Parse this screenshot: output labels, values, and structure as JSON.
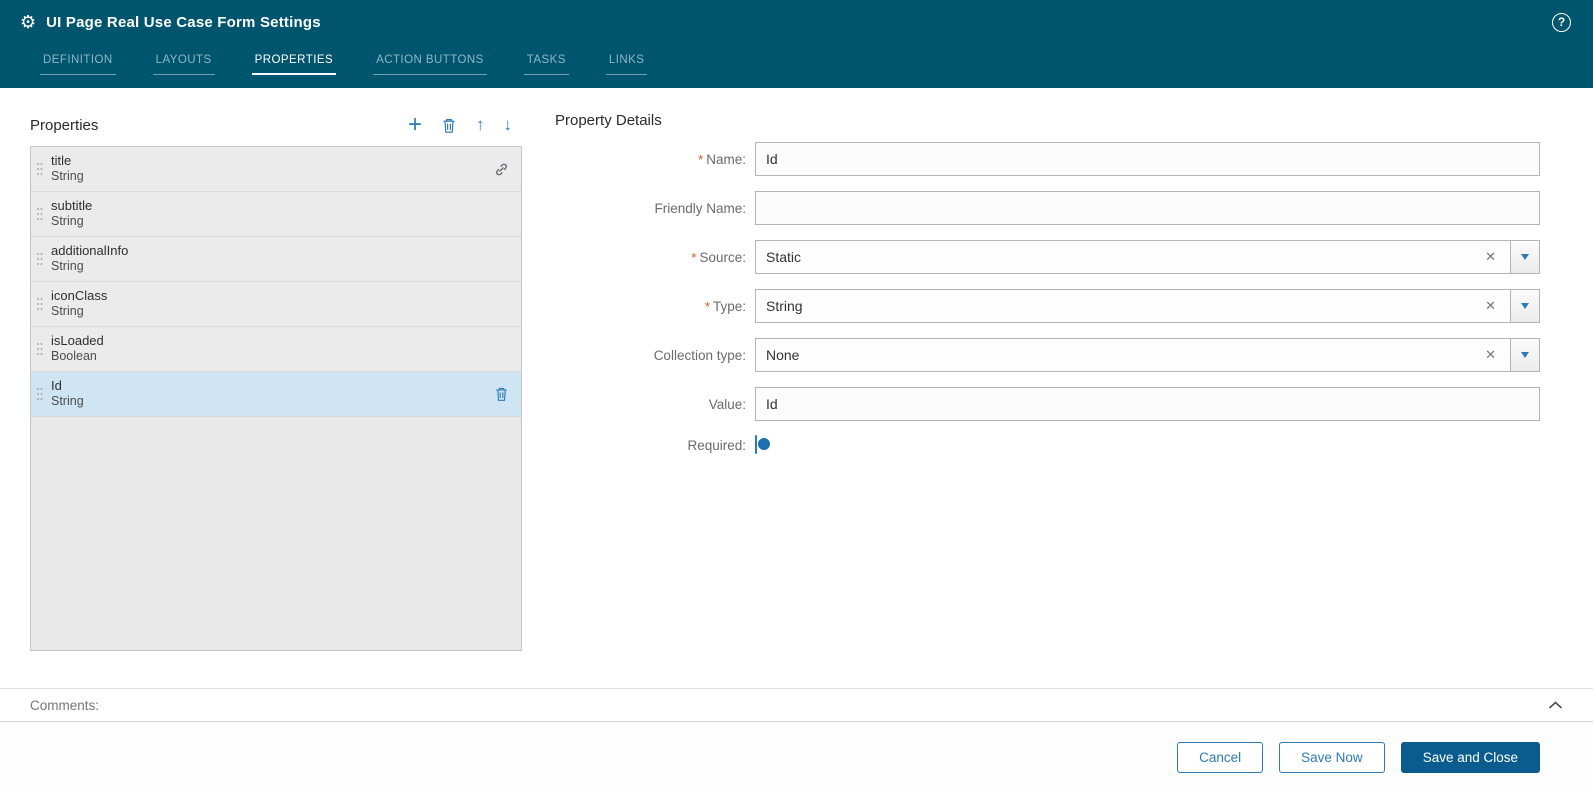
{
  "header": {
    "title": "UI Page Real Use Case Form Settings",
    "tabs": [
      {
        "label": "DEFINITION",
        "active": false
      },
      {
        "label": "LAYOUTS",
        "active": false
      },
      {
        "label": "PROPERTIES",
        "active": true
      },
      {
        "label": "ACTION BUTTONS",
        "active": false
      },
      {
        "label": "TASKS",
        "active": false
      },
      {
        "label": "LINKS",
        "active": false
      }
    ]
  },
  "icons": {
    "gear": "⚙",
    "help": "?",
    "add": "+",
    "move_up": "↑",
    "move_down": "↓",
    "clear": "✕"
  },
  "properties_panel": {
    "title": "Properties",
    "items": [
      {
        "name": "title",
        "type": "String"
      },
      {
        "name": "subtitle",
        "type": "String"
      },
      {
        "name": "additionalInfo",
        "type": "String"
      },
      {
        "name": "iconClass",
        "type": "String"
      },
      {
        "name": "isLoaded",
        "type": "Boolean"
      },
      {
        "name": "Id",
        "type": "String",
        "selected": true
      }
    ]
  },
  "details_panel": {
    "title": "Property Details",
    "required_mark": "*",
    "fields": {
      "name": {
        "label": "Name:",
        "required": true,
        "value": "Id"
      },
      "friendly_name": {
        "label": "Friendly Name:",
        "required": false,
        "value": ""
      },
      "source": {
        "label": "Source:",
        "required": true,
        "value": "Static"
      },
      "type": {
        "label": "Type:",
        "required": true,
        "value": "String"
      },
      "collection_type": {
        "label": "Collection type:",
        "required": false,
        "value": "None"
      },
      "value": {
        "label": "Value:",
        "required": false,
        "value": "Id"
      },
      "required": {
        "label": "Required:",
        "state": "off"
      }
    }
  },
  "comments": {
    "label": "Comments:"
  },
  "footer": {
    "cancel_label": "Cancel",
    "save_now_label": "Save Now",
    "save_and_close_label": "Save and Close"
  },
  "colors": {
    "header_bg": "#00556e",
    "accent": "#2e7bb4",
    "primary_button_bg": "#0b5c8e",
    "selected_row_bg": "#cfe5f4",
    "required_mark": "#d9531e"
  }
}
